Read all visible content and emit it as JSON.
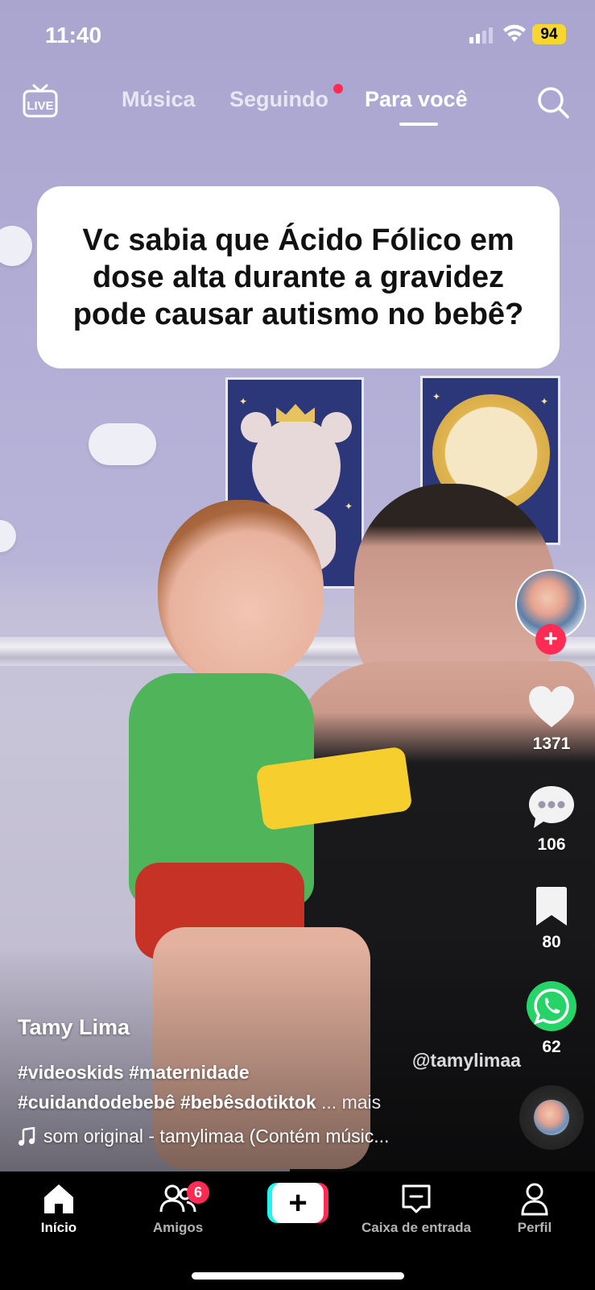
{
  "status_bar": {
    "time": "11:40",
    "battery": "94"
  },
  "top_nav": {
    "live_label": "LIVE",
    "tabs": [
      {
        "label": "Música",
        "active": false
      },
      {
        "label": "Seguindo",
        "active": false,
        "has_dot": true
      },
      {
        "label": "Para você",
        "active": true
      }
    ]
  },
  "video": {
    "caption_text": "Vc sabia que Ácido Fólico em dose alta durante a gravidez pode causar autismo no bebê?",
    "watermark": "@tamylimaa"
  },
  "actions": {
    "likes": "1371",
    "comments": "106",
    "saves": "80",
    "shares": "62"
  },
  "post": {
    "author": "Tamy Lima",
    "description_line1": "#videoskids #maternidade",
    "description_line2": "#cuidandodebebê #bebêsdotiktok",
    "more_label": "... mais",
    "sound": "som original - tamylimaa (Contém músic..."
  },
  "tab_bar": {
    "items": [
      {
        "label": "Início",
        "active": true
      },
      {
        "label": "Amigos",
        "badge": "6"
      },
      {
        "label": "+"
      },
      {
        "label": "Caixa de entrada"
      },
      {
        "label": "Perfil"
      }
    ]
  },
  "colors": {
    "accent": "#fe2c55",
    "cyan": "#25f4ee",
    "battery": "#f8d631",
    "whatsapp": "#25d366"
  },
  "icons": [
    "live-icon",
    "search-icon",
    "heart-icon",
    "comment-icon",
    "bookmark-icon",
    "whatsapp-icon",
    "music-note-icon",
    "home-icon",
    "friends-icon",
    "inbox-icon",
    "profile-icon"
  ]
}
